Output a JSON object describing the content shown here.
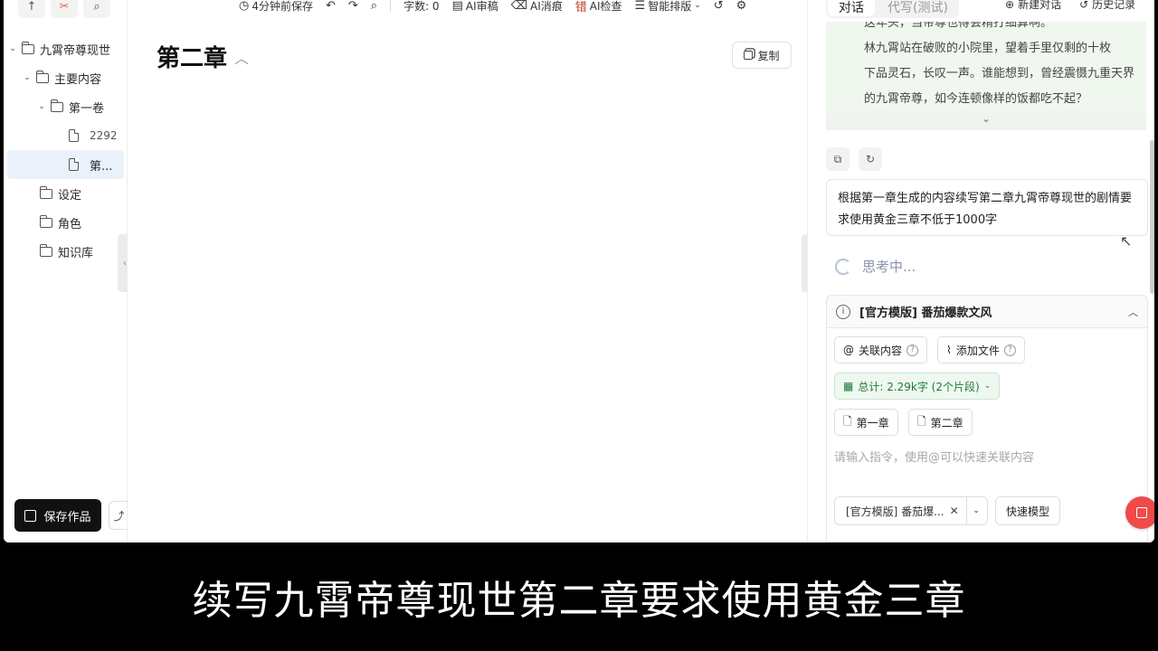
{
  "sidebar": {
    "top_icons": [
      "up-arrow-icon",
      "scissors-icon",
      "search-icon"
    ],
    "tree": [
      {
        "label": "九霄帝尊现世",
        "type": "folder",
        "level": 0,
        "expanded": true
      },
      {
        "label": "主要内容",
        "type": "folder",
        "level": 1,
        "expanded": true
      },
      {
        "label": "第一卷",
        "type": "folder",
        "level": 2,
        "expanded": true
      },
      {
        "label": "2292",
        "type": "file",
        "level": 3
      },
      {
        "label": "第...",
        "type": "file",
        "level": 3,
        "active": true
      },
      {
        "label": "设定",
        "type": "folder",
        "level": 1
      },
      {
        "label": "角色",
        "type": "folder",
        "level": 1
      },
      {
        "label": "知识库",
        "type": "folder",
        "level": 1
      }
    ],
    "save_label": "保存作品"
  },
  "toolbar": {
    "autosave": "4分钟前保存",
    "word_count": "字数: 0",
    "ai_review": "AI审稿",
    "ai_remove": "AI消痕",
    "ai_check": "AI检查",
    "smart_layout": "智能排版"
  },
  "editor": {
    "chapter_title": "第二章",
    "copy_label": "复制"
  },
  "panel": {
    "tabs": [
      "对话",
      "代写(测试)"
    ],
    "new_chat": "新建对话",
    "history": "历史记录",
    "preview_lines": [
      "这年头，当帝尊也得会精打细算啊。",
      "林九霄站在破败的小院里，望着手里仅剩的十枚",
      "下品灵石，长叹一声。谁能想到，曾经震慑九重天界",
      "的九霄帝尊，如今连顿像样的饭都吃不起？"
    ],
    "user_message": "根据第一章生成的内容续写第二章九霄帝尊现世的剧情要求使用黄金三章不低于1000字",
    "thinking": "思考中...",
    "template_title": "[官方模版] 番茄爆款文风",
    "link_content": "关联内容",
    "add_file": "添加文件",
    "total": "总计: 2.29k字 (2个片段)",
    "chapters": [
      "第一章",
      "第二章"
    ],
    "input_placeholder": "请输入指令，使用@可以快速关联内容",
    "model_select": "[官方模版] 番茄爆...",
    "fast_model": "快速模型",
    "accent_color": "#f04a4a",
    "green_color": "#1d7a38"
  },
  "subtitle": "续写九霄帝尊现世第二章要求使用黄金三章"
}
